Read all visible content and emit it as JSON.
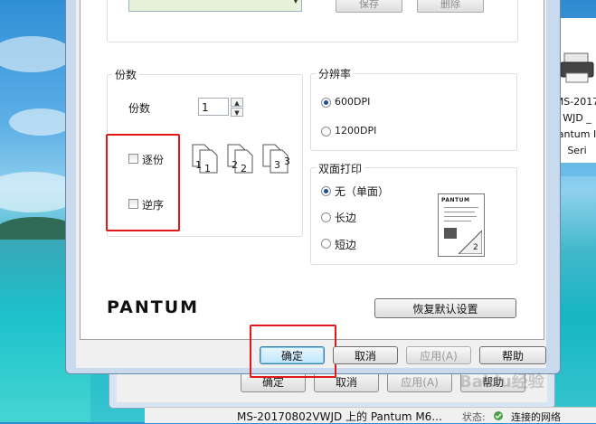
{
  "dialog": {
    "top_buttons": {
      "save": "保存",
      "delete": "删除"
    },
    "copies_group": {
      "title": "份数",
      "copies_label": "份数",
      "copies_value": "1",
      "collate_label": "逐份",
      "collate_checked": false,
      "reverse_label": "逆序",
      "reverse_checked": false,
      "page_numbers": [
        "1",
        "1",
        "2",
        "2",
        "3",
        "3"
      ]
    },
    "resolution_group": {
      "title": "分辨率",
      "options": [
        {
          "label": "600DPI",
          "selected": true
        },
        {
          "label": "1200DPI",
          "selected": false
        }
      ]
    },
    "duplex_group": {
      "title": "双面打印",
      "options": [
        {
          "label": "无（单面）",
          "selected": true
        },
        {
          "label": "长边",
          "selected": false
        },
        {
          "label": "短边",
          "selected": false
        }
      ],
      "preview_brand": "PANTUM",
      "preview_page": "2"
    },
    "brand_logo": "PANTUM",
    "restore_defaults_label": "恢复默认设置",
    "footer_buttons": {
      "ok": "确定",
      "cancel": "取消",
      "apply": "应用(A)",
      "help": "帮助"
    }
  },
  "background_window": {
    "buttons": {
      "ok": "确定",
      "cancel": "取消",
      "apply": "应用(A)",
      "help": "帮助"
    }
  },
  "desktop_peek": {
    "lines": [
      "MS-2017",
      "WJD _",
      "antum I",
      "Seri"
    ]
  },
  "status_bar": {
    "printer_text": "MS-20170802VWJD 上的 Pantum M6...",
    "status_label": "状态:",
    "status_value": "连接的网络"
  },
  "watermark": "Baidu经验",
  "colors": {
    "highlight_red": "#e01818",
    "default_button_blue": "#3c7fb1"
  }
}
